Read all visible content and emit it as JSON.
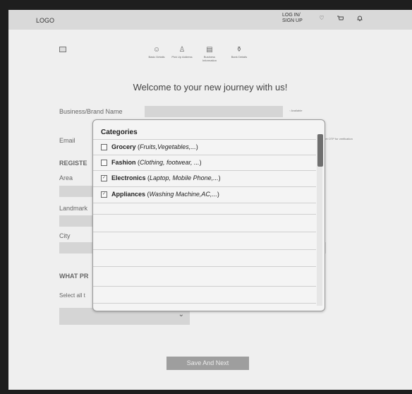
{
  "header": {
    "logo": "LOGO",
    "login_line1": "LOG IN/",
    "login_line2": "SIGN UP"
  },
  "steps": [
    {
      "label": "Basic Details"
    },
    {
      "label": "Pick Up Address"
    },
    {
      "label": "Business Information"
    },
    {
      "label": "Bank Details"
    }
  ],
  "welcome": "Welcome to your new journey with us!",
  "form": {
    "business_label": "Business/Brand Name",
    "available_text": "Available",
    "email_label": "Email",
    "otp_text": "get OTP for verification",
    "register_section": "REGISTE",
    "area_label": "Area",
    "landmark_label": "Landmark",
    "city_label": "City",
    "what_section": "WHAT PR",
    "select_all_label": "Select all t",
    "save_button": "Save And Next"
  },
  "categories": {
    "title": "Categories",
    "items": [
      {
        "name": "Grocery",
        "examples": "Fruits,Vegetables,...",
        "checked": false
      },
      {
        "name": "Fashion",
        "examples": "Clothing, footwear, ...",
        "checked": false
      },
      {
        "name": "Electronics",
        "examples": "Laptop, Mobile Phone,...",
        "checked": true
      },
      {
        "name": "Appliances",
        "examples": "Washing Machine,AC,...",
        "checked": true
      }
    ]
  }
}
